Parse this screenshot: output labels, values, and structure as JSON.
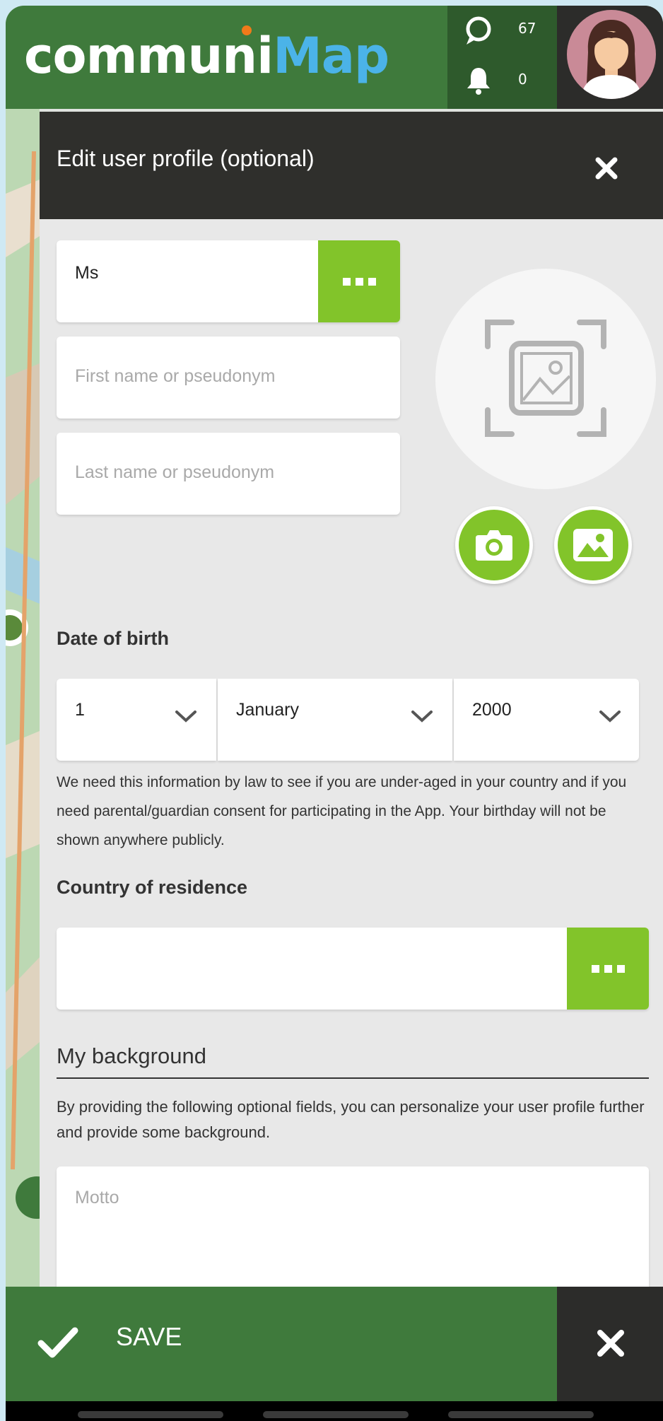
{
  "header": {
    "logo_part1": "communi",
    "logo_part2": "Map",
    "contributions_count": "67",
    "notifications_count": "0"
  },
  "panel": {
    "title": "Edit user profile (optional)"
  },
  "form": {
    "salutation_value": "Ms",
    "first_name_placeholder": "First name or pseudonym",
    "last_name_placeholder": "Last name or pseudonym",
    "dob_label": "Date of birth",
    "dob_day": "1",
    "dob_month": "January",
    "dob_year": "2000",
    "dob_note": "We need this information by law to see if you are under-aged in your country and if you need parental/guardian consent for participating in the App. Your birthday will not be shown anywhere publicly.",
    "country_label": "Country of residence",
    "country_value": "",
    "background_title": "My background",
    "background_desc": "By providing the following optional fields, you can personalize your user profile further and provide some background.",
    "motto_placeholder": "Motto"
  },
  "footer": {
    "save_label": "SAVE"
  },
  "colors": {
    "brand_green": "#3f7a3c",
    "accent_green": "#82c42a",
    "dark": "#2c2c2a",
    "logo_blue": "#4bb3e8"
  }
}
